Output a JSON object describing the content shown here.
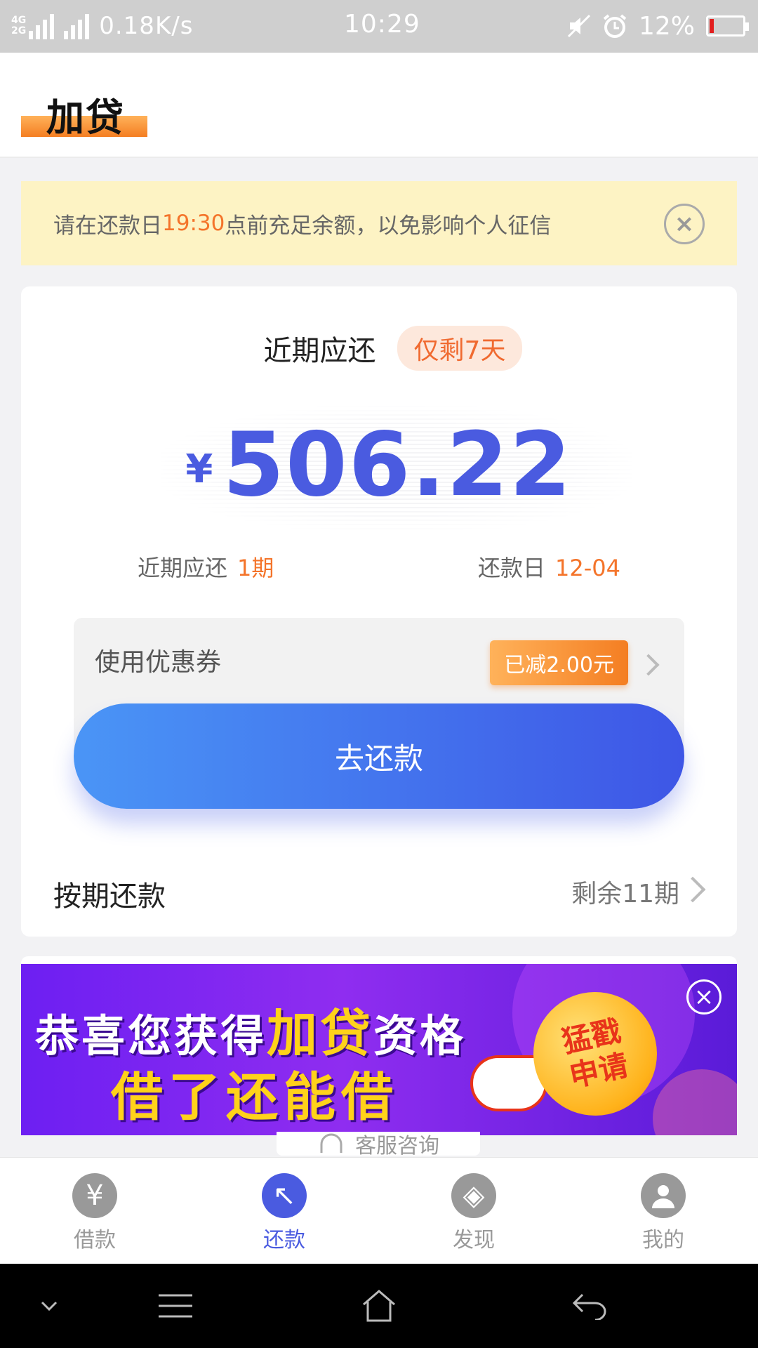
{
  "status_bar": {
    "signal_labels": [
      "4G",
      "4G",
      "2G"
    ],
    "net_speed": "0.18K/s",
    "time": "10:29",
    "battery": "12%",
    "battery_level": 0.12
  },
  "header": {
    "title": "加贷"
  },
  "notice": {
    "text_before": "请在还款日",
    "highlight": "19:30",
    "text_after": "点前充足余额，以免影响个人征信",
    "close_icon": "×"
  },
  "repayment": {
    "label": "近期应还",
    "days_badge": "仅剩7天",
    "currency": "¥",
    "amount": "506.22",
    "period_label": "近期应还",
    "period_value": "1期",
    "due_label": "还款日",
    "due_value": "12-04",
    "coupon_label": "使用优惠券",
    "coupon_badge": "已减2.00元",
    "pay_button": "去还款",
    "installments_label": "按期还款",
    "remaining": "剩余11期"
  },
  "banner": {
    "line1_a": "恭喜您获得",
    "line1_gold": "加贷",
    "line1_b": "资格",
    "line2": "借了还能借",
    "coin_line1": "猛戳",
    "coin_line2": "申请",
    "close_icon": "×"
  },
  "customer_service": {
    "label": "客服咨询"
  },
  "bottom_nav": [
    {
      "label": "借款",
      "icon": "yen-icon",
      "glyph": "¥",
      "active": false
    },
    {
      "label": "还款",
      "icon": "repay-arrow-icon",
      "glyph": "↖",
      "active": true
    },
    {
      "label": "发现",
      "icon": "compass-icon",
      "glyph": "◈",
      "active": false
    },
    {
      "label": "我的",
      "icon": "user-icon",
      "glyph": "●",
      "active": false
    }
  ],
  "colors": {
    "accent_blue": "#4a5be0",
    "accent_orange": "#f4742a",
    "notice_bg": "#fdf3c4"
  }
}
